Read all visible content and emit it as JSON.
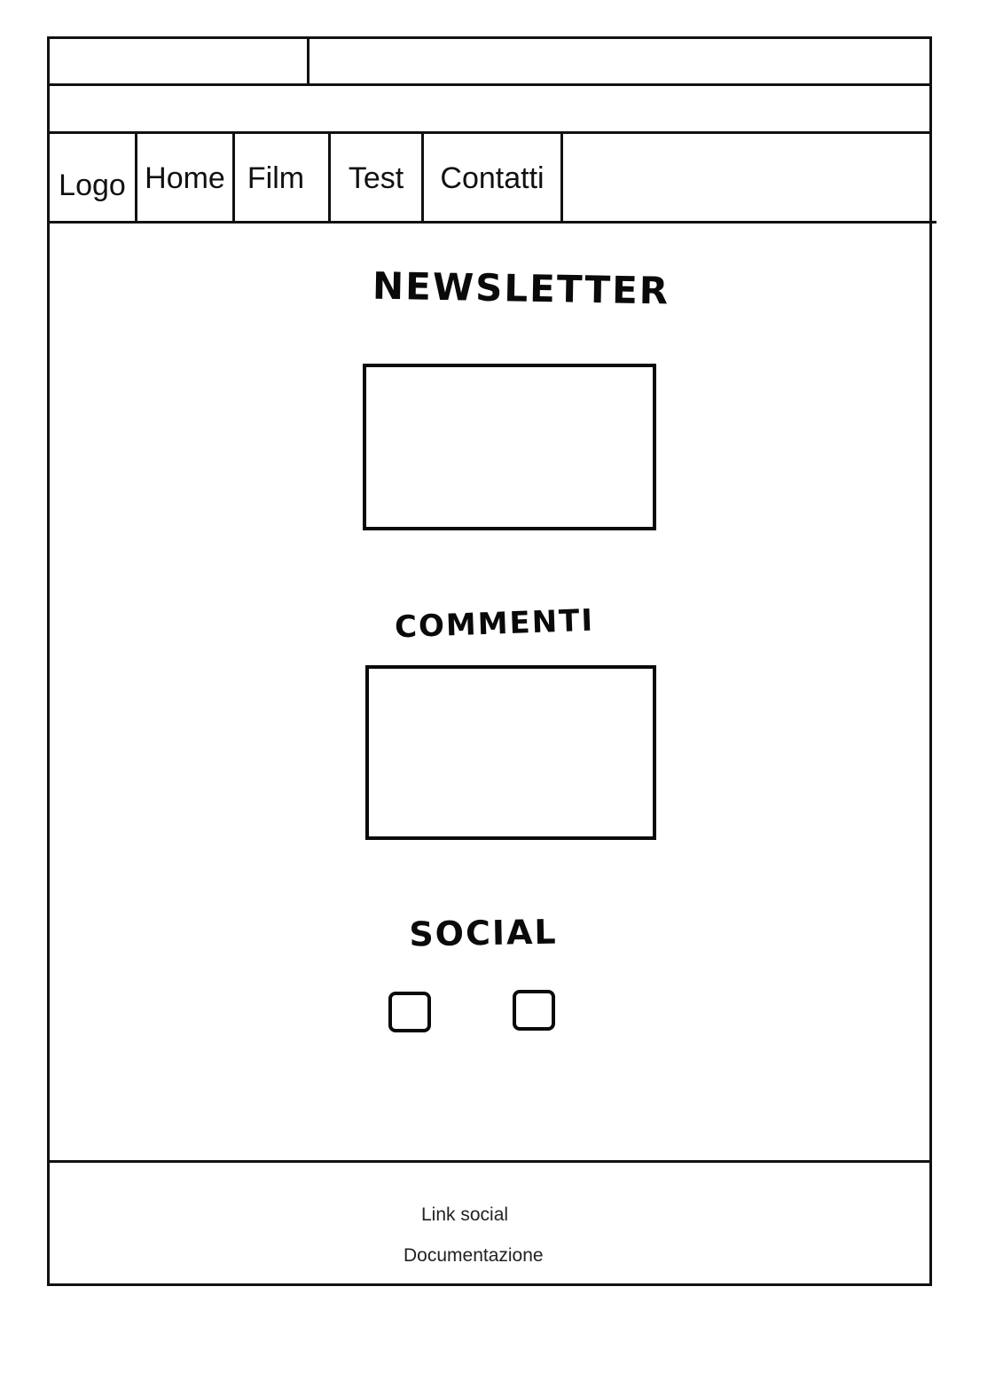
{
  "nav": {
    "items": [
      {
        "label": "Logo"
      },
      {
        "label": "Home"
      },
      {
        "label": "Film"
      },
      {
        "label": "Test"
      },
      {
        "label": "Contatti"
      }
    ]
  },
  "sections": {
    "newsletter_title": "NEWSLETTER",
    "comments_title": "COMMENTI",
    "social_title": "SOCIAL"
  },
  "footer": {
    "social_link": "Link social",
    "docs_link": "Documentazione"
  }
}
